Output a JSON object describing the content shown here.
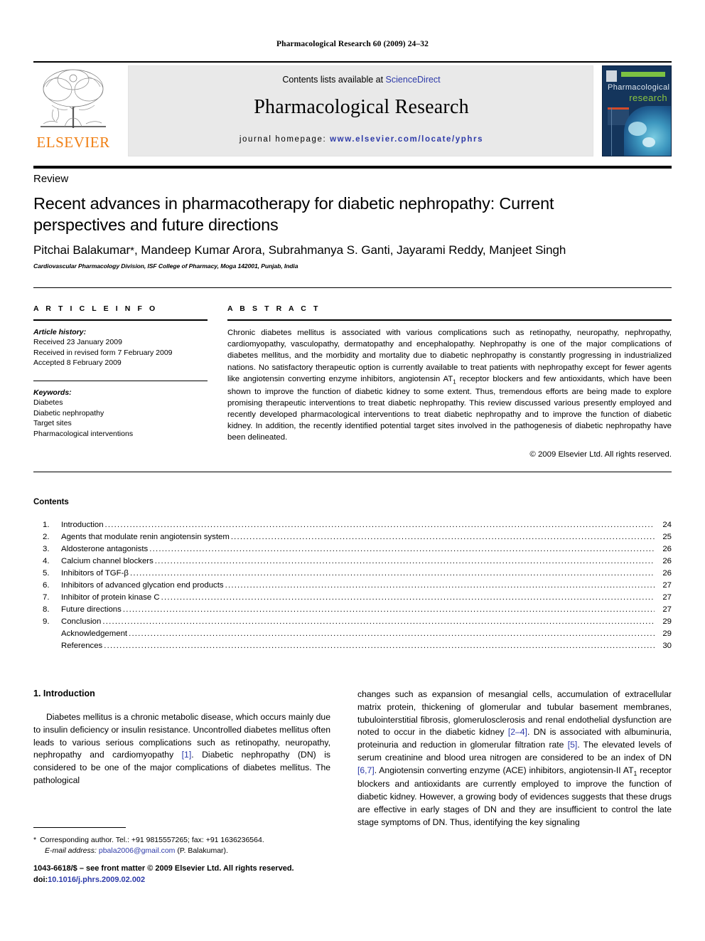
{
  "running_head": "Pharmacological Research 60 (2009) 24–32",
  "masthead": {
    "contents_prefix": "Contents lists available at ",
    "sciencedirect": "ScienceDirect",
    "journal_title": "Pharmacological Research",
    "homepage_label": "journal homepage: ",
    "homepage_url": "www.elsevier.com/locate/yphrs",
    "publisher_wordmark": "ELSEVIER",
    "publisher_color": "#F07F13",
    "link_color": "#2d3aa8"
  },
  "cover": {
    "line1": "Pharmacological",
    "line2": "research",
    "bg_color": "#14355c",
    "accent_color": "#7cc143"
  },
  "article": {
    "doctype": "Review",
    "title": "Recent advances in pharmacotherapy for diabetic nephropathy: Current perspectives and future directions",
    "authors": "Pitchai Balakumar",
    "authors_rest": ", Mandeep Kumar Arora, Subrahmanya S. Ganti, Jayarami Reddy, Manjeet Singh",
    "corresponding_marker": "*",
    "affiliation": "Cardiovascular Pharmacology Division, ISF College of Pharmacy, Moga 142001, Punjab, India"
  },
  "article_info": {
    "heading": "A R T I C L E   I N F O",
    "history_label": "Article history:",
    "history": [
      "Received 23 January 2009",
      "Received in revised form 7 February 2009",
      "Accepted 8 February 2009"
    ],
    "keywords_label": "Keywords:",
    "keywords": [
      "Diabetes",
      "Diabetic nephropathy",
      "Target sites",
      "Pharmacological interventions"
    ]
  },
  "abstract": {
    "heading": "A B S T R A C T",
    "text_part1": "Chronic diabetes mellitus is associated with various complications such as retinopathy, neuropathy, nephropathy, cardiomyopathy, vasculopathy, dermatopathy and encephalopathy. Nephropathy is one of the major complications of diabetes mellitus, and the morbidity and mortality due to diabetic nephropathy is constantly progressing in industrialized nations. No satisfactory therapeutic option is currently available to treat patients with nephropathy except for fewer agents like angiotensin converting enzyme inhibitors, angiotensin AT",
    "subscript": "1",
    "text_part2": " receptor blockers and few antioxidants, which have been shown to improve the function of diabetic kidney to some extent. Thus, tremendous efforts are being made to explore promising therapeutic interventions to treat diabetic nephropathy. This review discussed various presently employed and recently developed pharmacological interventions to treat diabetic nephropathy and to improve the function of diabetic kidney. In addition, the recently identified potential target sites involved in the pathogenesis of diabetic nephropathy have been delineated.",
    "copyright": "© 2009 Elsevier Ltd. All rights reserved."
  },
  "contents": {
    "heading": "Contents",
    "items": [
      {
        "num": "1.",
        "label": "Introduction",
        "page": "24"
      },
      {
        "num": "2.",
        "label": "Agents that modulate renin angiotensin system",
        "page": "25"
      },
      {
        "num": "3.",
        "label": "Aldosterone antagonists",
        "page": "26"
      },
      {
        "num": "4.",
        "label": "Calcium channel blockers",
        "page": "26"
      },
      {
        "num": "5.",
        "label": "Inhibitors of TGF-β",
        "page": "26"
      },
      {
        "num": "6.",
        "label": "Inhibitors of advanced glycation end products",
        "page": "27"
      },
      {
        "num": "7.",
        "label": "Inhibitor of protein kinase C",
        "page": "27"
      },
      {
        "num": "8.",
        "label": "Future directions",
        "page": "27"
      },
      {
        "num": "9.",
        "label": "Conclusion",
        "page": "29"
      },
      {
        "num": "",
        "label": "Acknowledgement",
        "page": "29"
      },
      {
        "num": "",
        "label": "References",
        "page": "30"
      }
    ]
  },
  "body": {
    "section_heading": "1.  Introduction",
    "left_p1_a": "Diabetes mellitus is a chronic metabolic disease, which occurs mainly due to insulin deficiency or insulin resistance. Uncontrolled diabetes mellitus often leads to various serious complications such as retinopathy, neuropathy, nephropathy and cardiomyopathy ",
    "left_ref1": "[1]",
    "left_p1_b": ". Diabetic nephropathy (DN) is considered to be one of the major complications of diabetes mellitus. The pathological",
    "right_p1_a": "changes such as expansion of mesangial cells, accumulation of extracellular matrix protein, thickening of glomerular and tubular basement membranes, tubulointerstitial fibrosis, glomerulosclerosis and renal endothelial dysfunction are noted to occur in the diabetic kidney ",
    "right_ref1": "[2–4]",
    "right_p1_b": ". DN is associated with albuminuria, proteinuria and reduction in glomerular filtration rate ",
    "right_ref2": "[5]",
    "right_p1_c": ". The elevated levels of serum creatinine and blood urea nitrogen are considered to be an index of DN ",
    "right_ref3": "[6,7]",
    "right_p1_d": ". Angiotensin converting enzyme (ACE) inhibitors, angiotensin-II AT",
    "right_sub": "1",
    "right_p1_e": " receptor blockers and antioxidants are currently employed to improve the function of diabetic kidney. However, a growing body of evidences suggests that these drugs are effective in early stages of DN and they are insufficient to control the late stage symptoms of DN. Thus, identifying the key signaling"
  },
  "footnotes": {
    "star": "*",
    "corresponding": "Corresponding author. Tel.: +91 9815557265; fax: +91 1636236564.",
    "email_label": "E-mail address:",
    "email": "pbala2006@gmail.com",
    "email_owner": "(P. Balakumar).",
    "imprint_line1": "1043-6618/$ – see front matter © 2009 Elsevier Ltd. All rights reserved.",
    "doi_label": "doi:",
    "doi": "10.1016/j.phrs.2009.02.002"
  }
}
